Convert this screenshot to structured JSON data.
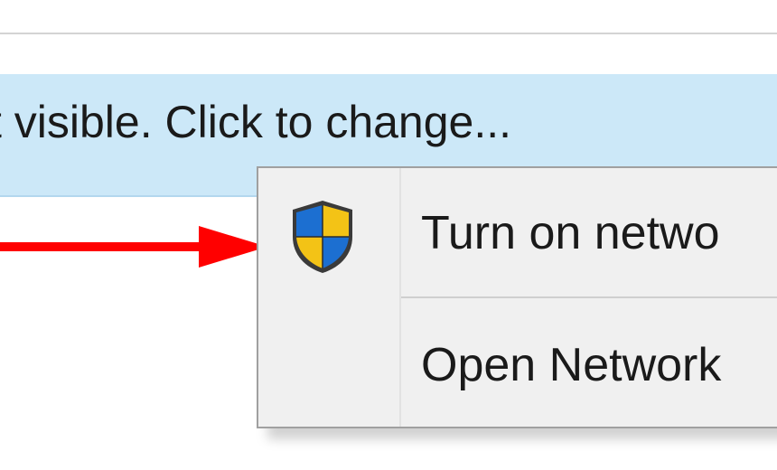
{
  "info_bar": {
    "text": "t visible. Click to change..."
  },
  "context_menu": {
    "items": [
      {
        "label": "Turn on netwo",
        "icon": "uac-shield-icon"
      },
      {
        "label": "Open Network"
      }
    ]
  },
  "colors": {
    "info_bar_bg": "#cce8f8",
    "menu_bg": "#f0f0f0",
    "arrow": "#ff0000",
    "shield_blue": "#1c6fd1",
    "shield_yellow": "#f3c316"
  }
}
